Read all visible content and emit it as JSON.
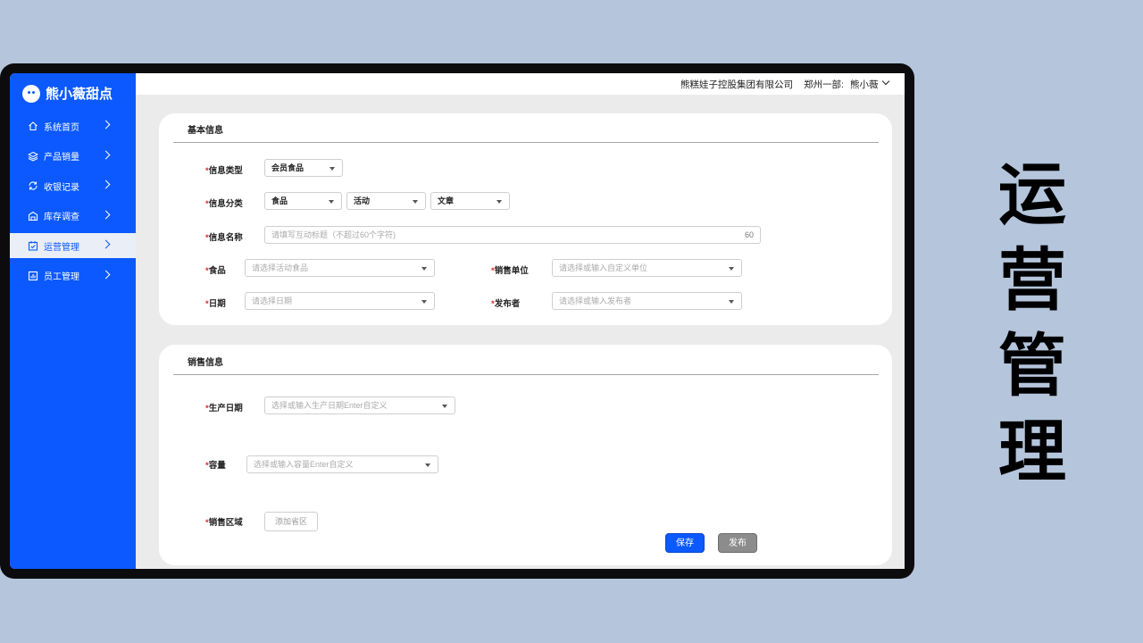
{
  "sidebar": {
    "logo_text": "熊小薇甜点",
    "items": [
      {
        "label": "系统首页",
        "icon": "home-icon"
      },
      {
        "label": "产品销量",
        "icon": "layers-icon"
      },
      {
        "label": "收银记录",
        "icon": "refresh-icon"
      },
      {
        "label": "库存调查",
        "icon": "inventory-icon"
      },
      {
        "label": "运营管理",
        "icon": "calendar-check-icon",
        "active": true
      },
      {
        "label": "员工管理",
        "icon": "chart-icon"
      }
    ]
  },
  "header": {
    "company": "熊糕娃子控股集团有限公司",
    "dept": "郑州一部:",
    "user": "熊小薇"
  },
  "basic_info": {
    "title": "基本信息",
    "info_type": {
      "label": "信息类型",
      "value": "会员食品"
    },
    "info_category": {
      "label": "信息分类",
      "values": [
        "食品",
        "活动",
        "文章"
      ]
    },
    "info_name": {
      "label": "信息名称",
      "placeholder": "请填写互动标题（不超过60个字符)",
      "count": "60"
    },
    "food": {
      "label": "食品",
      "placeholder": "请选择活动食品"
    },
    "sales_unit": {
      "label": "销售单位",
      "placeholder": "请选择或输入自定义单位"
    },
    "date": {
      "label": "日期",
      "placeholder": "请选择日期"
    },
    "publisher": {
      "label": "发布者",
      "placeholder": "请选择或输入发布者"
    }
  },
  "sales_info": {
    "title": "销售信息",
    "production_date": {
      "label": "生产日期",
      "placeholder": "选择或输入生产日期Enter自定义"
    },
    "capacity": {
      "label": "容量",
      "placeholder": "选择或输入容量Enter自定义"
    },
    "sales_region": {
      "label": "销售区域",
      "button": "添加省区"
    },
    "save": "保存",
    "publish": "发布"
  },
  "required_mark": "*",
  "side_title": [
    "运",
    "营",
    "管",
    "理"
  ],
  "colors": {
    "primary": "#0b59ff",
    "background": "#b4c5dc",
    "required": "#e4262b"
  }
}
